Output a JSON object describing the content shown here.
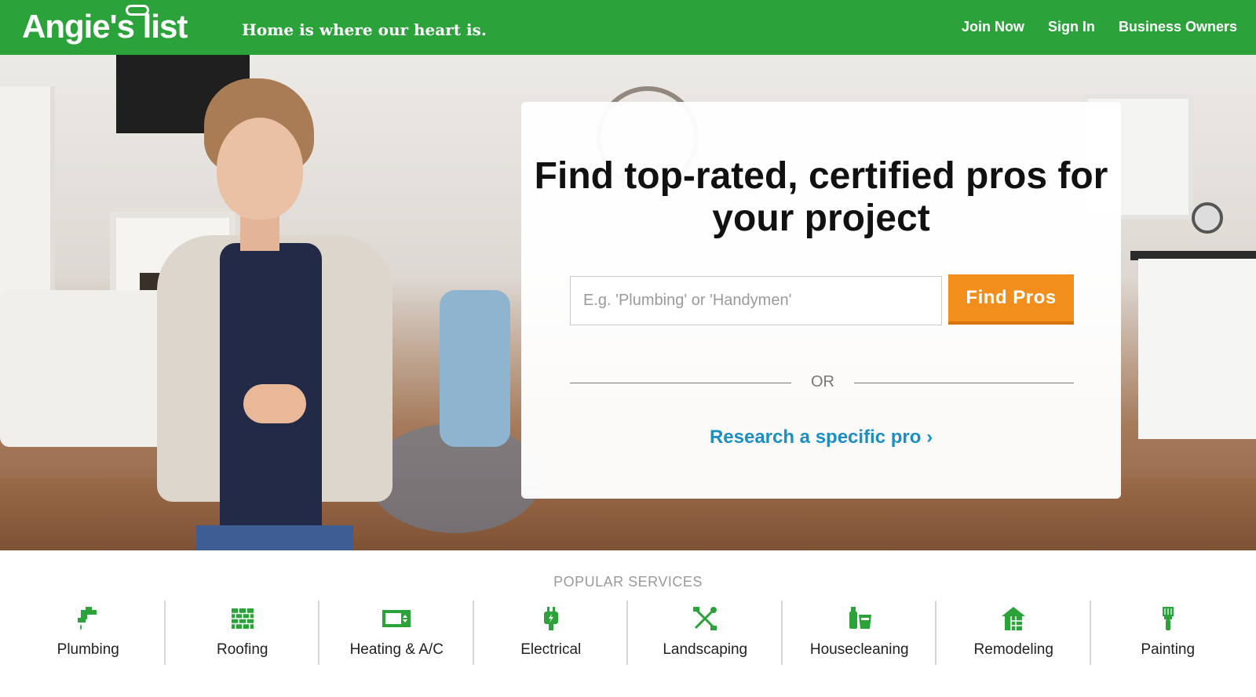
{
  "header": {
    "logo_text": "Angie's list",
    "tagline": "Home is where our heart is.",
    "nav": [
      {
        "label": "Join Now"
      },
      {
        "label": "Sign In"
      },
      {
        "label": "Business Owners"
      }
    ],
    "brand_color": "#2ba23a"
  },
  "hero": {
    "headline": "Find top-rated, certified pros for your project",
    "search": {
      "placeholder": "E.g. 'Plumbing' or 'Handymen'",
      "value": "",
      "button_label": "Find Pros"
    },
    "separator_text": "OR",
    "research_link": "Research a specific pro ›",
    "accent_color": "#f28e1c",
    "link_color": "#1b8fc0"
  },
  "popular": {
    "title": "POPULAR SERVICES",
    "services": [
      {
        "label": "Plumbing",
        "icon": "faucet-icon"
      },
      {
        "label": "Roofing",
        "icon": "brick-icon"
      },
      {
        "label": "Heating & A/C",
        "icon": "hvac-icon"
      },
      {
        "label": "Electrical",
        "icon": "plug-icon"
      },
      {
        "label": "Landscaping",
        "icon": "garden-tools-icon"
      },
      {
        "label": "Housecleaning",
        "icon": "cleaning-supplies-icon"
      },
      {
        "label": "Remodeling",
        "icon": "house-frame-icon"
      },
      {
        "label": "Painting",
        "icon": "paintbrush-icon"
      }
    ]
  }
}
